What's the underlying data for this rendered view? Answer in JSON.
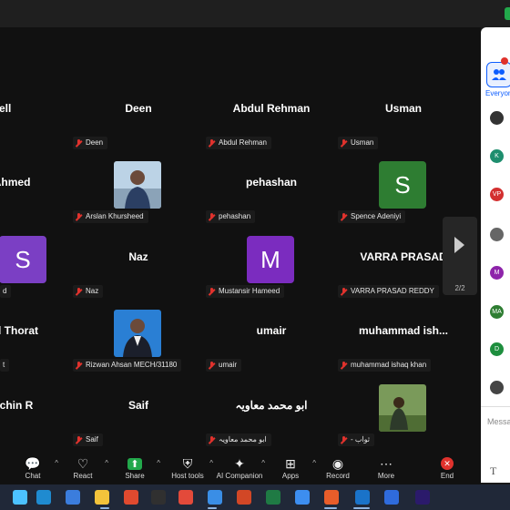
{
  "participants": [
    {
      "big_name": "dell",
      "label": ""
    },
    {
      "big_name": "Deen",
      "label": "Deen"
    },
    {
      "big_name": "Abdul Rehman",
      "label": "Abdul Rehman"
    },
    {
      "big_name": "Usman",
      "label": "Usman"
    },
    {
      "big_name": "l Ahmed",
      "label": ""
    },
    {
      "big_name": "",
      "label": "Arslan Khursheed"
    },
    {
      "big_name": "pehashan",
      "label": "pehashan"
    },
    {
      "big_name": "",
      "label": "Spence Adeniyi",
      "avatar_letter": "S",
      "avatar_color": "#2e7d32"
    },
    {
      "big_name": "",
      "label": "d",
      "avatar_letter": "S",
      "avatar_color": "#7b3fc4"
    },
    {
      "big_name": "Naz",
      "label": "Naz"
    },
    {
      "big_name": "",
      "label": "Mustansir Hameed",
      "avatar_letter": "M",
      "avatar_color": "#7b2cbf"
    },
    {
      "big_name": "VARRA  PRASAD",
      "label": "VARRA PRASAD REDDY"
    },
    {
      "big_name": "d Thorat",
      "label": "t"
    },
    {
      "big_name": "",
      "label": "Rizwan Ahsan MECH/31180"
    },
    {
      "big_name": "umair",
      "label": "umair"
    },
    {
      "big_name": "muhammad  ish...",
      "label": "muhammad ishaq khan"
    },
    {
      "big_name": "chin R",
      "label": ""
    },
    {
      "big_name": "Saif",
      "label": "Saif"
    },
    {
      "big_name": "ابو محمد معاویہ",
      "label": "ابو محمد معاویہ"
    },
    {
      "big_name": "",
      "label": "- ثواب"
    }
  ],
  "pagination": "2/2",
  "panel": {
    "tab_label": "Everyone",
    "message_placeholder": "Messa",
    "format_glyph": "T",
    "avatars": [
      {
        "text": ""
      },
      {
        "text": "K"
      },
      {
        "text": "VP"
      },
      {
        "text": ""
      },
      {
        "text": "M"
      },
      {
        "text": "MA"
      },
      {
        "text": "D"
      },
      {
        "text": ""
      }
    ],
    "avatar_colors": [
      "#333",
      "#1e8e6e",
      "#d32f2f",
      "#666",
      "#8e24aa",
      "#2e7d32",
      "#1e8e3e",
      "#444"
    ]
  },
  "toolbar": {
    "items": [
      {
        "label": "Chat",
        "icon": "chat-icon"
      },
      {
        "label": "React",
        "icon": "heart-icon"
      },
      {
        "label": "Share",
        "icon": "share-icon"
      },
      {
        "label": "Host tools",
        "icon": "shield-icon"
      },
      {
        "label": "AI Companion",
        "icon": "sparkle-icon"
      },
      {
        "label": "Apps",
        "icon": "apps-icon"
      },
      {
        "label": "Record",
        "icon": "record-icon"
      },
      {
        "label": "More",
        "icon": "more-icon"
      },
      {
        "label": "End",
        "icon": "end-icon"
      }
    ]
  },
  "colors": {
    "accent": "#0b5cff",
    "mute": "#e0322d",
    "share": "#22a84b",
    "end": "#e0322d"
  }
}
